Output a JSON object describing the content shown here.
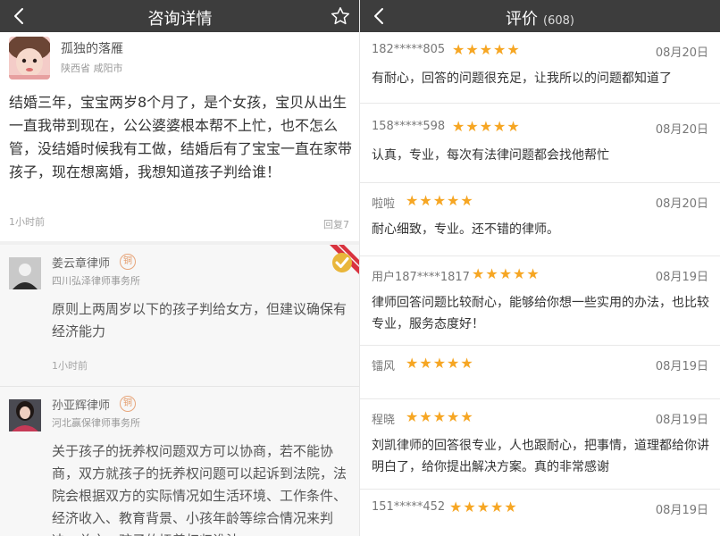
{
  "left": {
    "nav": {
      "title": "咨询详情"
    },
    "question": {
      "user": "孤独的落雁",
      "location": "陕西省 咸阳市",
      "text": "结婚三年，宝宝两岁8个月了，是个女孩，宝贝从出生一直我带到现在，公公婆婆根本帮不上忙，也不怎么管，没结婚时候我有工做，结婚后有了宝宝一直在家带孩子，现在想离婚，我想知道孩子判给谁！",
      "time": "1小时前",
      "reply": "回复7"
    },
    "answers": [
      {
        "name": "姜云章律师",
        "badge": "铜",
        "firm": "四川弘泽律师事务所",
        "text": "原则上两周岁以下的孩子判给女方，但建议确保有经济能力",
        "time": "1小时前"
      },
      {
        "name": "孙亚辉律师",
        "badge": "铜",
        "firm": "河北赢保律师事务所",
        "text": "关于孩子的抚养权问题双方可以协商，若不能协商，双方就孩子的抚养权问题可以起诉到法院，法院会根据双方的实际情况如生活环境、工作条件、经济收入、教育背景、小孩年龄等综合情况来判决。总之，孩子的抚养权归谁法"
      }
    ]
  },
  "right": {
    "nav": {
      "title": "评价",
      "count": "(608)"
    },
    "reviews": [
      {
        "user": "182*****805",
        "stars": 5,
        "date": "08月20日",
        "comment": "有耐心，回答的问题很充足，让我所以的问题都知道了"
      },
      {
        "user": "158*****598",
        "stars": 5,
        "date": "08月20日",
        "comment": "认真，专业，每次有法律问题都会找他帮忙"
      },
      {
        "user": "啦啦",
        "stars": 5,
        "date": "08月20日",
        "comment": "耐心细致，专业。还不错的律师。"
      },
      {
        "user": "用户187****1817",
        "stars": 5,
        "date": "08月19日",
        "comment": "律师回答问题比较耐心，能够给你想一些实用的办法，也比较专业，服务态度好！"
      },
      {
        "user": "镭风",
        "stars": 5,
        "date": "08月19日",
        "comment": ""
      },
      {
        "user": "程晓",
        "stars": 5,
        "date": "08月19日",
        "comment": "刘凯律师的回答很专业，人也跟耐心，把事情，道理都给你讲明白了，给你提出解决方案。真的非常感谢"
      },
      {
        "user": "151*****452",
        "stars": 5,
        "date": "08月19日",
        "comment": ""
      }
    ]
  }
}
